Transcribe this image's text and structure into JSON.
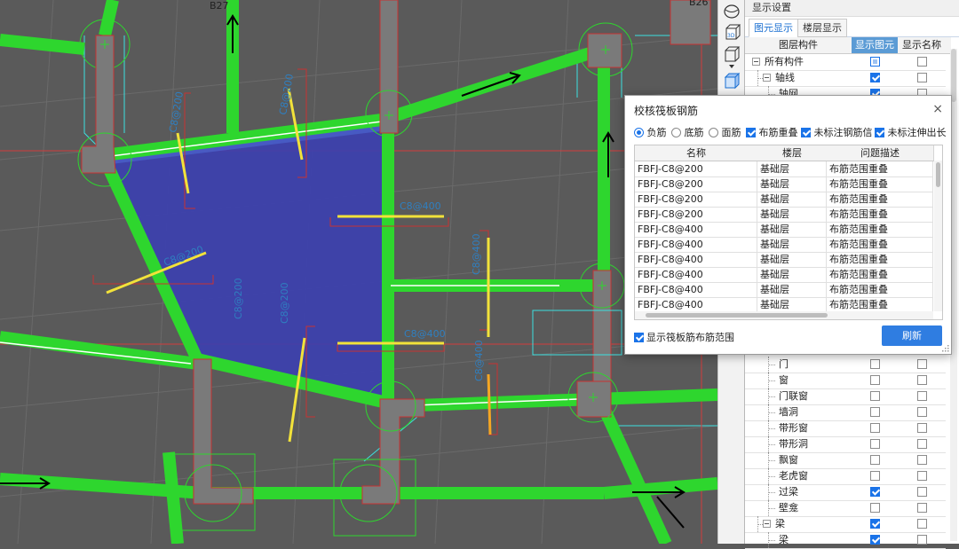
{
  "canvas": {
    "tags": [
      "B27",
      "B26"
    ],
    "dims": [
      "1240",
      "1240"
    ],
    "colors": {
      "background": "#5a5a5a",
      "wall": "#2ed62e",
      "slab": "#3b3fb0",
      "column": "#7a7a7a",
      "rebar_yellow": "#f2e23a",
      "rebar_orange": "#f5a623",
      "dimension_red": "#c83232",
      "axis_red": "#d23c3c",
      "text_blue": "#2f7fc0",
      "cyan_line": "#3ce0e0"
    }
  },
  "toolbar_icons": [
    "sphere-icon",
    "3d-box-icon",
    "box-outline-icon",
    "dropdown-arrow-icon",
    "solid-box-icon"
  ],
  "panel": {
    "title": "显示设置",
    "tabs": [
      {
        "label": "图元显示",
        "active": true
      },
      {
        "label": "楼层显示",
        "active": false
      }
    ],
    "columns": [
      "图层构件",
      "显示图元",
      "显示名称"
    ],
    "top_rows": [
      {
        "label": "所有构件",
        "level": 0,
        "expander": true,
        "show": "partial",
        "name": false
      },
      {
        "label": "轴线",
        "level": 1,
        "expander": true,
        "show": true,
        "name": false
      },
      {
        "label": "轴网",
        "level": 2,
        "expander": false,
        "show": true,
        "name": false
      }
    ],
    "bottom_rows": [
      {
        "label": "门",
        "level": 2,
        "expander": false,
        "show": false,
        "name": false
      },
      {
        "label": "窗",
        "level": 2,
        "expander": false,
        "show": false,
        "name": false
      },
      {
        "label": "门联窗",
        "level": 2,
        "expander": false,
        "show": false,
        "name": false
      },
      {
        "label": "墙洞",
        "level": 2,
        "expander": false,
        "show": false,
        "name": false
      },
      {
        "label": "带形窗",
        "level": 2,
        "expander": false,
        "show": false,
        "name": false
      },
      {
        "label": "带形洞",
        "level": 2,
        "expander": false,
        "show": false,
        "name": false
      },
      {
        "label": "飘窗",
        "level": 2,
        "expander": false,
        "show": false,
        "name": false
      },
      {
        "label": "老虎窗",
        "level": 2,
        "expander": false,
        "show": false,
        "name": false
      },
      {
        "label": "过梁",
        "level": 2,
        "expander": false,
        "show": true,
        "name": false
      },
      {
        "label": "壁龛",
        "level": 2,
        "expander": false,
        "show": false,
        "name": false
      },
      {
        "label": "梁",
        "level": 1,
        "expander": true,
        "show": true,
        "name": false
      },
      {
        "label": "梁",
        "level": 2,
        "expander": false,
        "show": true,
        "name": false
      }
    ]
  },
  "dialog": {
    "title": "校核筏板钢筋",
    "close": "×",
    "radios": [
      {
        "label": "负筋",
        "selected": true
      },
      {
        "label": "底筋",
        "selected": false
      },
      {
        "label": "面筋",
        "selected": false
      }
    ],
    "checks": [
      {
        "label": "布筋重叠",
        "checked": true
      },
      {
        "label": "未标注钢筋信",
        "checked": true
      },
      {
        "label": "未标注伸出长",
        "checked": true
      }
    ],
    "columns": [
      "名称",
      "楼层",
      "问题描述"
    ],
    "rows": [
      [
        "FBFJ-C8@200",
        "基础层",
        "布筋范围重叠"
      ],
      [
        "FBFJ-C8@200",
        "基础层",
        "布筋范围重叠"
      ],
      [
        "FBFJ-C8@200",
        "基础层",
        "布筋范围重叠"
      ],
      [
        "FBFJ-C8@200",
        "基础层",
        "布筋范围重叠"
      ],
      [
        "FBFJ-C8@400",
        "基础层",
        "布筋范围重叠"
      ],
      [
        "FBFJ-C8@400",
        "基础层",
        "布筋范围重叠"
      ],
      [
        "FBFJ-C8@400",
        "基础层",
        "布筋范围重叠"
      ],
      [
        "FBFJ-C8@400",
        "基础层",
        "布筋范围重叠"
      ],
      [
        "FBFJ-C8@400",
        "基础层",
        "布筋范围重叠"
      ],
      [
        "FBFJ-C8@400",
        "基础层",
        "布筋范围重叠"
      ]
    ],
    "show_range": {
      "label": "显示筏板筋布筋范围",
      "checked": true
    },
    "refresh_label": "刷新"
  }
}
